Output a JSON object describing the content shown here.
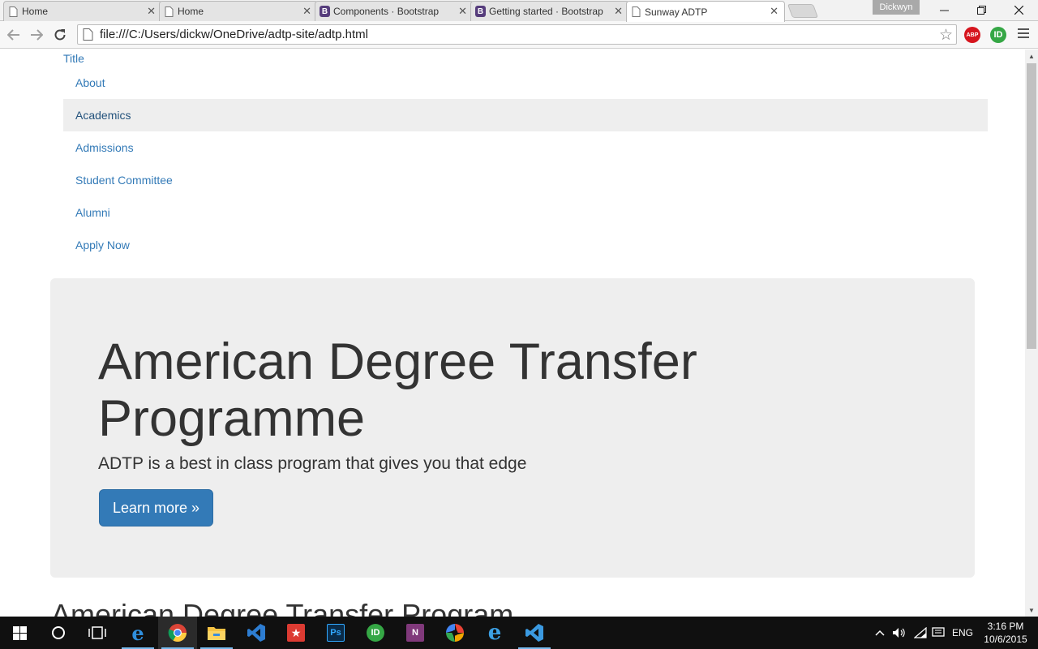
{
  "browser": {
    "tabs": [
      {
        "title": "Home",
        "icon": "page-icon",
        "active": false
      },
      {
        "title": "Home",
        "icon": "page-icon",
        "active": false
      },
      {
        "title": "Components · Bootstrap",
        "icon": "bootstrap-icon",
        "active": false
      },
      {
        "title": "Getting started · Bootstrap",
        "icon": "bootstrap-icon",
        "active": false
      },
      {
        "title": "Sunway ADTP",
        "icon": "page-icon",
        "active": true
      }
    ],
    "profile_name": "Dickwyn",
    "address": "file:///C:/Users/dickw/OneDrive/adtp-site/adtp.html",
    "extensions": {
      "abp": "ABP",
      "id": "ID"
    }
  },
  "page": {
    "brand": "Title",
    "nav_items": [
      {
        "label": "About",
        "active": false
      },
      {
        "label": "Academics",
        "active": true
      },
      {
        "label": "Admissions",
        "active": false
      },
      {
        "label": "Student Committee",
        "active": false
      },
      {
        "label": "Alumni",
        "active": false
      },
      {
        "label": "Apply Now",
        "active": false
      }
    ],
    "jumbotron": {
      "title": "American Degree Transfer Programme",
      "lead": "ADTP is a best in class program that gives you that edge",
      "button": "Learn more »"
    },
    "section_heading": "American Degree Transfer Program"
  },
  "taskbar": {
    "apps": [
      "start",
      "cortana-search",
      "task-view",
      "edge",
      "chrome",
      "file-explorer",
      "visual-studio",
      "wunderlist",
      "photoshop",
      "id-app",
      "onenote",
      "picasa",
      "internet-explorer",
      "visual-studio-code"
    ],
    "language": "ENG",
    "time": "3:16 PM",
    "date": "10/6/2015"
  },
  "colors": {
    "link": "#337ab7",
    "jumbotron_bg": "#eeeeee",
    "primary_button": "#337ab7",
    "taskbar": "#101010"
  }
}
